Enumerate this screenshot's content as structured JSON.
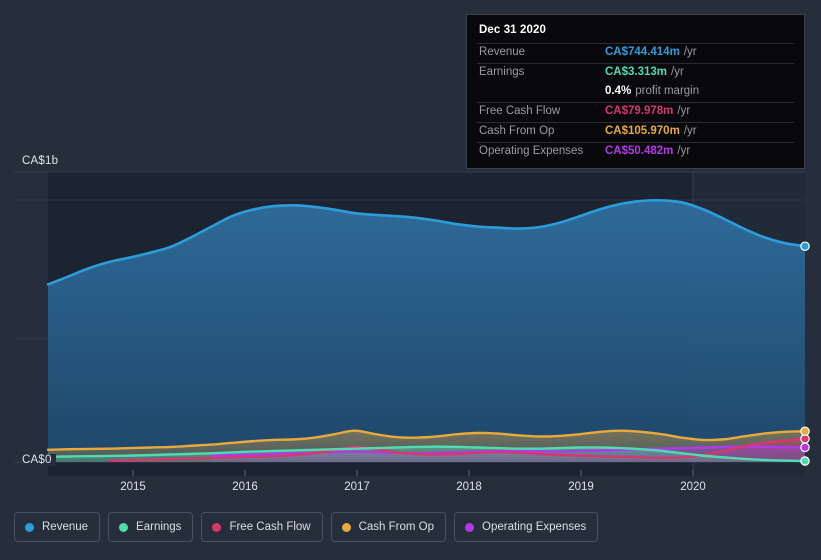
{
  "chart_data": {
    "type": "area",
    "title": "",
    "xlabel": "",
    "ylabel": "",
    "currency": "CA$",
    "grid": true,
    "legend_position": "bottom",
    "ylim": [
      0,
      1000
    ],
    "y_ticks": [
      {
        "value": 1000,
        "label": "CA$1b"
      },
      {
        "value": 0,
        "label": "CA$0"
      }
    ],
    "x_ticks": [
      "2015",
      "2016",
      "2017",
      "2018",
      "2019",
      "2020"
    ],
    "x_range": [
      "2014.3",
      "2021.0"
    ],
    "series": [
      {
        "name": "Revenue",
        "color": "#2d9cdb",
        "unit": "m",
        "values": [
          612,
          640,
          668,
          690,
          705,
          722,
          742,
          775,
          812,
          848,
          870,
          882,
          885,
          880,
          870,
          858,
          852,
          848,
          842,
          832,
          820,
          812,
          808,
          805,
          810,
          825,
          848,
          872,
          890,
          900,
          902,
          895,
          872,
          840,
          805,
          775,
          755,
          744
        ]
      },
      {
        "name": "Earnings",
        "color": "#4fdcb0",
        "unit": "m",
        "values": [
          18,
          19,
          20,
          21,
          22,
          24,
          26,
          28,
          30,
          33,
          36,
          38,
          40,
          42,
          44,
          46,
          48,
          50,
          52,
          53,
          52,
          50,
          48,
          46,
          46,
          48,
          50,
          50,
          48,
          44,
          38,
          30,
          22,
          16,
          11,
          7,
          5,
          3.313
        ]
      },
      {
        "name": "Free Cash Flow",
        "color": "#d6376f",
        "unit": "m",
        "values": [
          null,
          null,
          null,
          5,
          6,
          8,
          10,
          12,
          14,
          16,
          18,
          20,
          24,
          30,
          40,
          52,
          44,
          34,
          28,
          26,
          28,
          32,
          34,
          32,
          28,
          24,
          22,
          20,
          18,
          16,
          14,
          16,
          24,
          38,
          54,
          66,
          74,
          79.978
        ]
      },
      {
        "name": "Cash From Op",
        "color": "#e8a93d",
        "unit": "m",
        "values": [
          42,
          44,
          45,
          46,
          48,
          50,
          52,
          56,
          60,
          66,
          72,
          76,
          78,
          84,
          96,
          108,
          96,
          86,
          84,
          88,
          96,
          100,
          98,
          92,
          88,
          90,
          96,
          104,
          108,
          104,
          96,
          84,
          76,
          78,
          88,
          98,
          104,
          105.97
        ]
      },
      {
        "name": "Operating Expenses",
        "color": "#b13ae8",
        "unit": "m",
        "values": [
          null,
          null,
          null,
          null,
          null,
          null,
          null,
          null,
          22,
          24,
          26,
          28,
          30,
          32,
          34,
          36,
          34,
          32,
          31,
          32,
          34,
          36,
          38,
          38,
          37,
          36,
          38,
          40,
          42,
          44,
          46,
          48,
          50,
          52,
          53,
          52,
          51,
          50.482
        ]
      }
    ]
  },
  "tooltip": {
    "date": "Dec 31 2020",
    "rows": [
      {
        "key": "Revenue",
        "value": "CA$744.414m",
        "unit": "/yr",
        "color": "#2d9cdb",
        "divider": true
      },
      {
        "key": "Earnings",
        "value": "CA$3.313m",
        "unit": "/yr",
        "color": "#4fdcb0",
        "divider": true
      },
      {
        "key": "",
        "value": "0.4%",
        "unit": "profit margin",
        "color": "#ffffff",
        "divider": false
      },
      {
        "key": "Free Cash Flow",
        "value": "CA$79.978m",
        "unit": "/yr",
        "color": "#d6376f",
        "divider": true
      },
      {
        "key": "Cash From Op",
        "value": "CA$105.970m",
        "unit": "/yr",
        "color": "#e8a93d",
        "divider": true
      },
      {
        "key": "Operating Expenses",
        "value": "CA$50.482m",
        "unit": "/yr",
        "color": "#b13ae8",
        "divider": true
      }
    ]
  },
  "legend": {
    "items": [
      {
        "label": "Revenue",
        "color": "#2d9cdb"
      },
      {
        "label": "Earnings",
        "color": "#4fdcb0"
      },
      {
        "label": "Free Cash Flow",
        "color": "#d6376f"
      },
      {
        "label": "Cash From Op",
        "color": "#e8a93d"
      },
      {
        "label": "Operating Expenses",
        "color": "#b13ae8"
      }
    ]
  },
  "axis": {
    "y_top_label": "CA$1b",
    "y_bottom_label": "CA$0",
    "x_labels": [
      "2015",
      "2016",
      "2017",
      "2018",
      "2019",
      "2020"
    ]
  },
  "theme": {
    "background": "#262e3c",
    "plot_background": "#1d2431",
    "plot_background_recent": "#212a3a",
    "gridline": "#3b4354",
    "tooltip_background": "#09090b",
    "tooltip_border": "#3a4050"
  }
}
